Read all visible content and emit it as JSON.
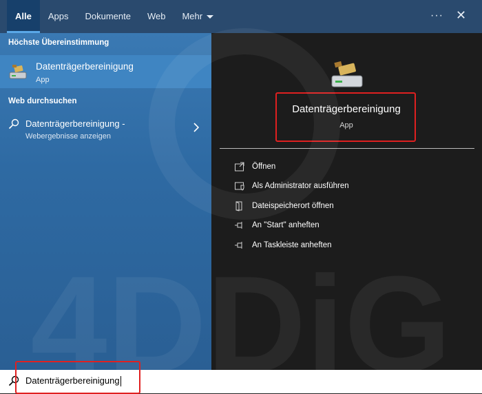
{
  "tabs": {
    "all": "Alle",
    "apps": "Apps",
    "documents": "Dokumente",
    "web": "Web",
    "more": "Mehr"
  },
  "top_actions": {
    "options": "···",
    "close": "✕"
  },
  "left": {
    "best_match_heading": "Höchste Übereinstimmung",
    "best_match": {
      "title": "Datenträgerbereinigung",
      "subtitle": "App"
    },
    "web_heading": "Web durchsuchen",
    "web_result": {
      "title": "Datenträgerbereinigung -",
      "subtitle": "Webergebnisse anzeigen"
    }
  },
  "detail": {
    "title": "Datenträgerbereinigung",
    "subtitle": "App",
    "actions": [
      {
        "label": "Öffnen",
        "icon": "open-icon"
      },
      {
        "label": "Als Administrator ausführen",
        "icon": "admin-shield-icon"
      },
      {
        "label": "Dateispeicherort öffnen",
        "icon": "file-location-icon"
      },
      {
        "label": "An \"Start\" anheften",
        "icon": "pin-icon"
      },
      {
        "label": "An Taskleiste anheften",
        "icon": "pin-icon"
      }
    ]
  },
  "search": {
    "query": "Datenträgerbereinigung"
  },
  "watermark": "4DDiG",
  "colors": {
    "accent_box": "#e02020",
    "selected_tab": "#17406b",
    "left_panel": "#2e6aa3",
    "right_panel": "#1c1c1c"
  }
}
